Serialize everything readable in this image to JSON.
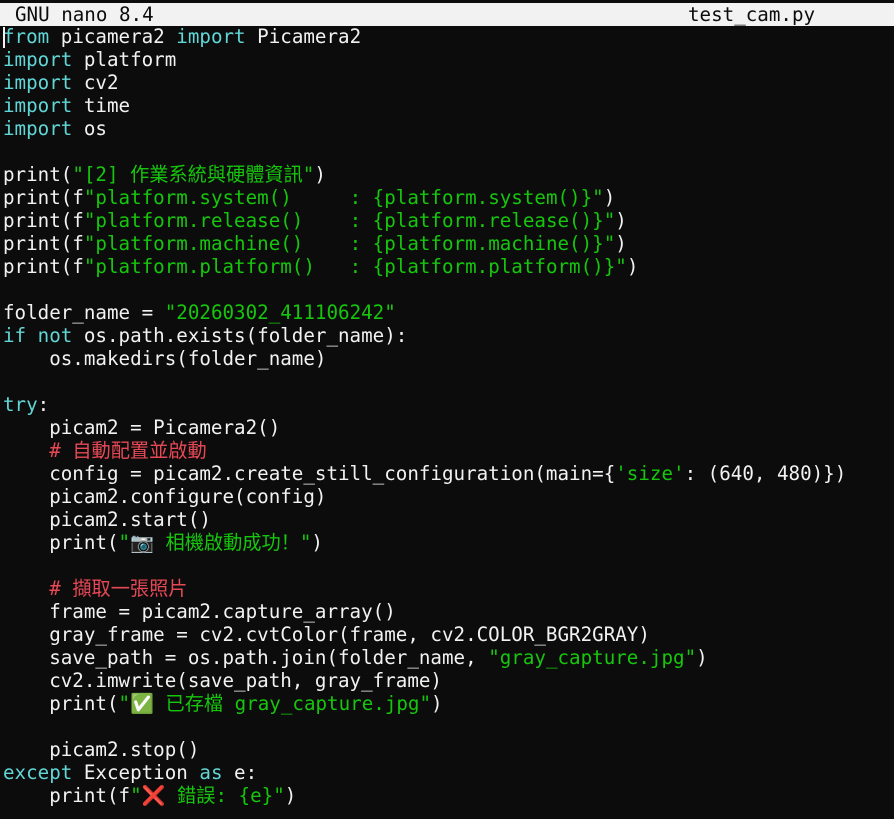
{
  "titlebar": {
    "app": "GNU nano 8.4",
    "filename": "test_cam.py"
  },
  "colors": {
    "background": "#0c0c0c",
    "foreground": "#f2f2f2",
    "keyword": "#61d6d6",
    "string": "#16c60c",
    "comment": "#e74856",
    "titlebar_bg": "#f2f2f2"
  },
  "code_lines": [
    [
      {
        "t": "kw",
        "v": "from"
      },
      {
        "t": "tx",
        "v": " picamera2 "
      },
      {
        "t": "kw",
        "v": "import"
      },
      {
        "t": "tx",
        "v": " Picamera2"
      }
    ],
    [
      {
        "t": "kw",
        "v": "import"
      },
      {
        "t": "tx",
        "v": " platform"
      }
    ],
    [
      {
        "t": "kw",
        "v": "import"
      },
      {
        "t": "tx",
        "v": " cv2"
      }
    ],
    [
      {
        "t": "kw",
        "v": "import"
      },
      {
        "t": "tx",
        "v": " time"
      }
    ],
    [
      {
        "t": "kw",
        "v": "import"
      },
      {
        "t": "tx",
        "v": " os"
      }
    ],
    [],
    [
      {
        "t": "tx",
        "v": "print("
      },
      {
        "t": "str",
        "v": "\"[2] 作業系統與硬體資訊\""
      },
      {
        "t": "tx",
        "v": ")"
      }
    ],
    [
      {
        "t": "tx",
        "v": "print(f"
      },
      {
        "t": "str",
        "v": "\"platform.system()     : {platform.system()}\""
      },
      {
        "t": "tx",
        "v": ")"
      }
    ],
    [
      {
        "t": "tx",
        "v": "print(f"
      },
      {
        "t": "str",
        "v": "\"platform.release()    : {platform.release()}\""
      },
      {
        "t": "tx",
        "v": ")"
      }
    ],
    [
      {
        "t": "tx",
        "v": "print(f"
      },
      {
        "t": "str",
        "v": "\"platform.machine()    : {platform.machine()}\""
      },
      {
        "t": "tx",
        "v": ")"
      }
    ],
    [
      {
        "t": "tx",
        "v": "print(f"
      },
      {
        "t": "str",
        "v": "\"platform.platform()   : {platform.platform()}\""
      },
      {
        "t": "tx",
        "v": ")"
      }
    ],
    [],
    [
      {
        "t": "tx",
        "v": "folder_name = "
      },
      {
        "t": "str",
        "v": "\"20260302_411106242\""
      }
    ],
    [
      {
        "t": "kw",
        "v": "if not"
      },
      {
        "t": "tx",
        "v": " os.path.exists(folder_name):"
      }
    ],
    [
      {
        "t": "tx",
        "v": "    os.makedirs(folder_name)"
      }
    ],
    [],
    [
      {
        "t": "kw",
        "v": "try"
      },
      {
        "t": "tx",
        "v": ":"
      }
    ],
    [
      {
        "t": "tx",
        "v": "    picam2 = Picamera2()"
      }
    ],
    [
      {
        "t": "tx",
        "v": "    "
      },
      {
        "t": "cmt",
        "v": "# 自動配置並啟動"
      }
    ],
    [
      {
        "t": "tx",
        "v": "    config = picam2.create_still_configuration(main={"
      },
      {
        "t": "str",
        "v": "'size'"
      },
      {
        "t": "tx",
        "v": ": (640, 480)})"
      }
    ],
    [
      {
        "t": "tx",
        "v": "    picam2.configure(config)"
      }
    ],
    [
      {
        "t": "tx",
        "v": "    picam2.start()"
      }
    ],
    [
      {
        "t": "tx",
        "v": "    print("
      },
      {
        "t": "str",
        "v": "\"📷 相機啟動成功！\""
      },
      {
        "t": "tx",
        "v": ")"
      }
    ],
    [],
    [
      {
        "t": "tx",
        "v": "    "
      },
      {
        "t": "cmt",
        "v": "# 擷取一張照片"
      }
    ],
    [
      {
        "t": "tx",
        "v": "    frame = picam2.capture_array()"
      }
    ],
    [
      {
        "t": "tx",
        "v": "    gray_frame = cv2.cvtColor(frame, cv2.COLOR_BGR2GRAY)"
      }
    ],
    [
      {
        "t": "tx",
        "v": "    save_path = os.path.join(folder_name, "
      },
      {
        "t": "str",
        "v": "\"gray_capture.jpg\""
      },
      {
        "t": "tx",
        "v": ")"
      }
    ],
    [
      {
        "t": "tx",
        "v": "    cv2.imwrite(save_path, gray_frame)"
      }
    ],
    [
      {
        "t": "tx",
        "v": "    print("
      },
      {
        "t": "str",
        "v": "\"✅ 已存檔 gray_capture.jpg\""
      },
      {
        "t": "tx",
        "v": ")"
      }
    ],
    [],
    [
      {
        "t": "tx",
        "v": "    picam2.stop()"
      }
    ],
    [
      {
        "t": "kw",
        "v": "except"
      },
      {
        "t": "tx",
        "v": " Exception "
      },
      {
        "t": "kw",
        "v": "as"
      },
      {
        "t": "tx",
        "v": " e:"
      }
    ],
    [
      {
        "t": "tx",
        "v": "    print(f"
      },
      {
        "t": "str",
        "v": "\"❌ 錯誤: {e}\""
      },
      {
        "t": "tx",
        "v": ")"
      }
    ]
  ]
}
